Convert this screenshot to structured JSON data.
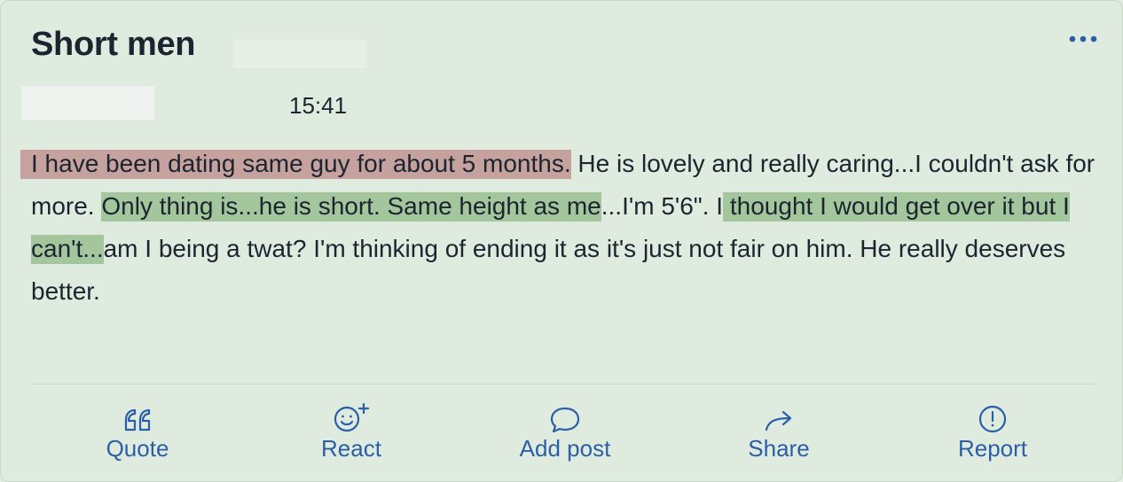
{
  "post": {
    "title": "Short men",
    "time": "15:41",
    "body": {
      "highlight_red": "I have been dating same guy for about 5 months.",
      "seg1": " He is lovely and really caring...I couldn't ask for more. ",
      "highlight_green_1": "Only thing is...he is short. Same height as me",
      "seg2": "...I'm 5'6\". I ",
      "highlight_green_2": "thought I would get over it but I can't...",
      "seg3": "am I being a twat? I'm thinking of ending it as it's just not fair on him. He really deserves better."
    }
  },
  "actions": {
    "quote": "Quote",
    "react": "React",
    "add_post": "Add post",
    "share": "Share",
    "report": "Report"
  },
  "colors": {
    "background": "#e0ebdf",
    "link_blue": "#2a5fa8",
    "highlight_red": "#c6a29f",
    "highlight_green": "#a3c69c"
  },
  "icons": {
    "more": "ellipsis-icon",
    "quote": "quote-icon",
    "react": "smiley-plus-icon",
    "add_post": "speech-bubble-icon",
    "share": "share-arrow-icon",
    "report": "exclamation-circle-icon"
  }
}
